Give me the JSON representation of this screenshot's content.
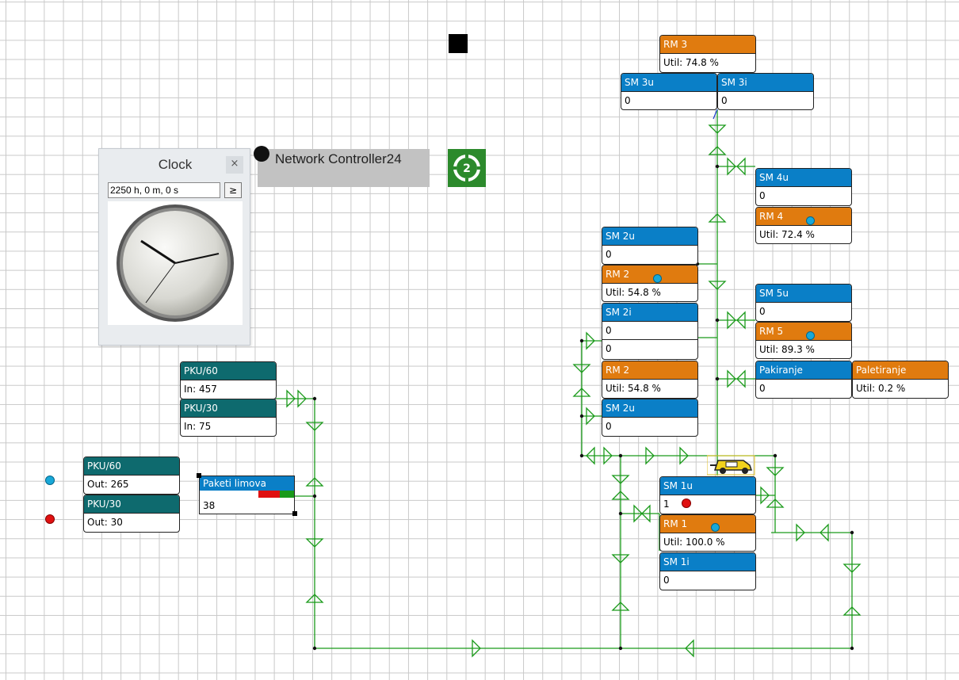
{
  "clock": {
    "title": "Clock",
    "close_label": "×",
    "time_value": "2250 h, 0 m, 0 s",
    "step_button_label": "≥"
  },
  "network_controller": {
    "label": "Network Controller24",
    "icon_number": "2"
  },
  "blocks": {
    "rm3": {
      "title": "RM 3",
      "value": "Util: 74.8 %"
    },
    "sm3u": {
      "title": "SM 3u",
      "value": "0"
    },
    "sm3i": {
      "title": "SM 3i",
      "value": "0"
    },
    "sm4u": {
      "title": "SM 4u",
      "value": "0"
    },
    "rm4": {
      "title": "RM 4",
      "value": "Util: 72.4 %"
    },
    "sm2u_top": {
      "title": "SM 2u",
      "value": "0"
    },
    "rm2_top": {
      "title": "RM 2",
      "value": "Util: 54.8 %"
    },
    "sm2i": {
      "title": "SM 2i",
      "value1": "0",
      "value2": "0"
    },
    "rm2_low": {
      "title": "RM 2",
      "value": "Util: 54.8 %"
    },
    "sm2u_low": {
      "title": "SM 2u",
      "value": "0"
    },
    "sm5u": {
      "title": "SM 5u",
      "value": "0"
    },
    "rm5": {
      "title": "RM 5",
      "value": "Util: 89.3 %"
    },
    "pakiranje": {
      "title": "Pakiranje",
      "value": "0"
    },
    "paletiranje": {
      "title": "Paletiranje",
      "value": "Util: 0.2 %"
    },
    "sm1u": {
      "title": "SM 1u",
      "value": "1"
    },
    "rm1": {
      "title": "RM 1",
      "value": "Util: 100.0 %"
    },
    "sm1i": {
      "title": "SM 1i",
      "value": "0"
    },
    "pku60_in": {
      "title": "PKU/60",
      "value": "In: 457"
    },
    "pku30_in": {
      "title": "PKU/30",
      "value": "In: 75"
    },
    "pku60_out": {
      "title": "PKU/60",
      "value": "Out: 265"
    },
    "pku30_out": {
      "title": "PKU/30",
      "value": "Out: 30"
    },
    "paketi": {
      "title": "Paketi limova",
      "value": "38"
    }
  },
  "colors": {
    "server_blue": "#0a7fc7",
    "resource_orange": "#e07b0f",
    "counter_teal": "#0e6a6e",
    "wire_green": "#1a9a1a",
    "status_red": "#e01010",
    "status_cyan": "#18a8d8"
  },
  "icons": [
    "clock-face-icon",
    "network-icon",
    "truck-icon",
    "status-dot-icon",
    "arrow-icon"
  ]
}
